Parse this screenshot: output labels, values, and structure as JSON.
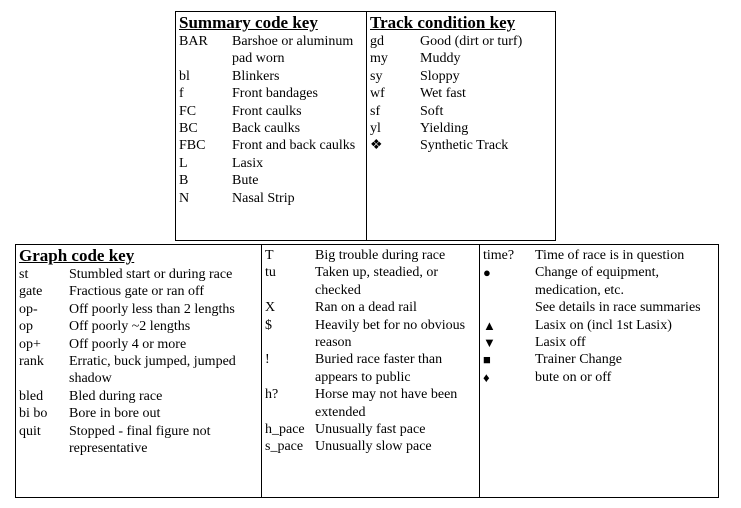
{
  "summary_key": {
    "title": "Summary code key",
    "items": [
      {
        "code": "BAR",
        "desc": "Barshoe or aluminum pad worn"
      },
      {
        "code": "bl",
        "desc": "Blinkers"
      },
      {
        "code": "f",
        "desc": "Front bandages"
      },
      {
        "code": "FC",
        "desc": "Front caulks"
      },
      {
        "code": "BC",
        "desc": "Back caulks"
      },
      {
        "code": "FBC",
        "desc": "Front and back caulks"
      },
      {
        "code": "L",
        "desc": "Lasix"
      },
      {
        "code": "B",
        "desc": "Bute"
      },
      {
        "code": "N",
        "desc": "Nasal Strip"
      }
    ]
  },
  "track_key": {
    "title": "Track condition key",
    "items": [
      {
        "code": "gd",
        "desc": "Good (dirt or turf)"
      },
      {
        "code": "my",
        "desc": "Muddy"
      },
      {
        "code": "sy",
        "desc": "Sloppy"
      },
      {
        "code": "wf",
        "desc": "Wet fast"
      },
      {
        "code": "sf",
        "desc": "Soft"
      },
      {
        "code": "yl",
        "desc": "Yielding"
      },
      {
        "code": "❖",
        "desc": "Synthetic Track"
      }
    ]
  },
  "graph_key": {
    "title": "Graph code key",
    "col1": [
      {
        "code": "st",
        "desc": "Stumbled start or during race"
      },
      {
        "code": "gate",
        "desc": "Fractious gate or ran off"
      },
      {
        "code": "op-",
        "desc": "Off poorly less than 2 lengths"
      },
      {
        "code": "op",
        "desc": "Off poorly ~2 lengths"
      },
      {
        "code": "op+",
        "desc": "Off poorly 4 or more"
      },
      {
        "code": "rank",
        "desc": "Erratic, buck jumped, jumped shadow"
      },
      {
        "code": "bled",
        "desc": "Bled during race"
      },
      {
        "code": "bi bo",
        "desc": "Bore in bore out"
      },
      {
        "code": "quit",
        "desc": "Stopped - final figure not representative"
      }
    ],
    "col2": [
      {
        "code": "T",
        "desc": "Big trouble during race"
      },
      {
        "code": "tu",
        "desc": "Taken up, steadied, or checked"
      },
      {
        "code": "X",
        "desc": "Ran on a dead rail"
      },
      {
        "code": "$",
        "desc": "Heavily bet for no obvious reason"
      },
      {
        "code": "!",
        "desc": "Buried race faster than appears to public"
      },
      {
        "code": "h?",
        "desc": "Horse may not have been extended"
      },
      {
        "code": "h_pace",
        "desc": "Unusually fast pace"
      },
      {
        "code": "s_pace",
        "desc": "Unusually slow pace"
      }
    ],
    "col3": [
      {
        "code": "time?",
        "desc": "Time of race is in question",
        "icon": ""
      },
      {
        "code": "●",
        "desc": "Change of equipment, medication, etc.",
        "icon": "filled-circle-icon"
      },
      {
        "code": "",
        "desc": "See details in race summaries",
        "icon": ""
      },
      {
        "code": "▲",
        "desc": "Lasix on (incl 1st Lasix)",
        "icon": "triangle-up-icon"
      },
      {
        "code": "▼",
        "desc": "Lasix off",
        "icon": "triangle-down-icon"
      },
      {
        "code": "■",
        "desc": "Trainer Change",
        "icon": "square-icon"
      },
      {
        "code": "♦",
        "desc": "bute on or off",
        "icon": "diamond-icon"
      }
    ]
  }
}
